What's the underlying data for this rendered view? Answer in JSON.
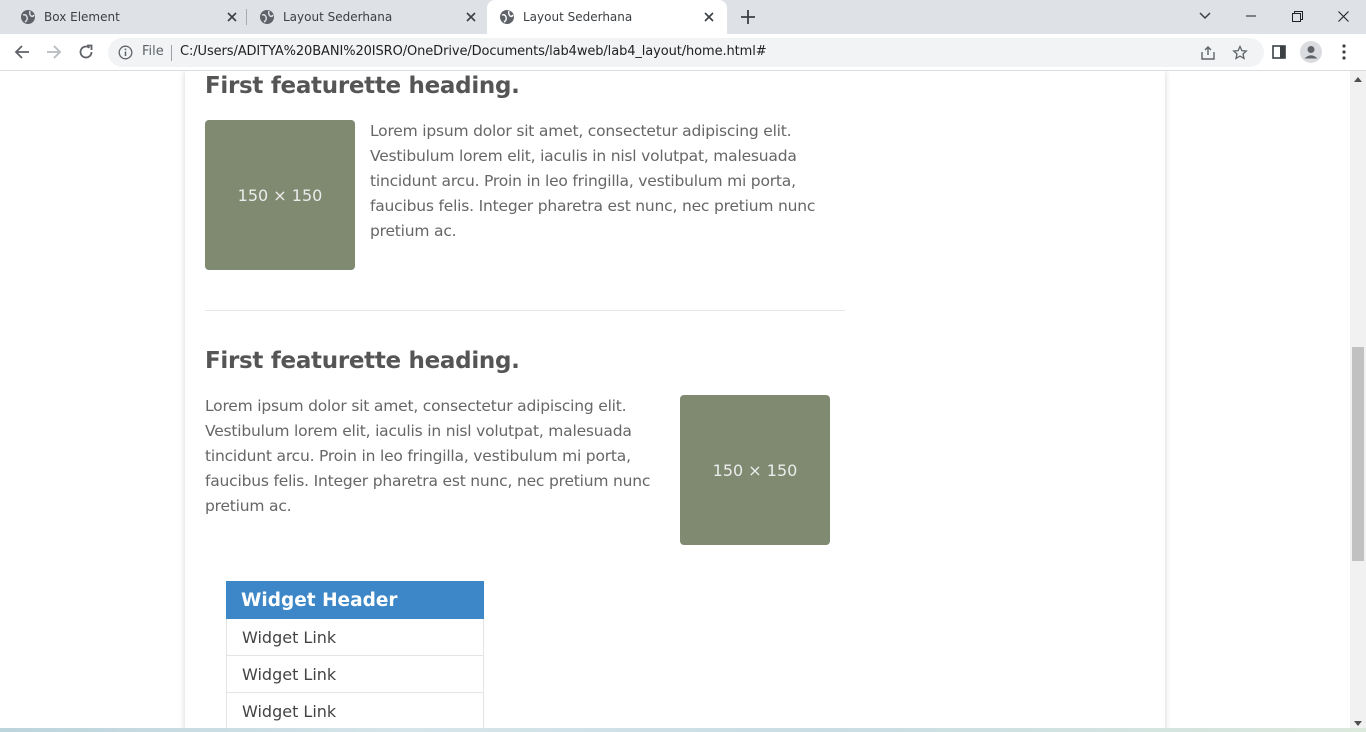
{
  "browser": {
    "tabs": [
      {
        "title": "Box Element",
        "active": false
      },
      {
        "title": "Layout Sederhana",
        "active": false
      },
      {
        "title": "Layout Sederhana",
        "active": true
      }
    ],
    "address": {
      "scheme_label": "File",
      "url": "C:/Users/ADITYA%20BANI%20ISRO/OneDrive/Documents/lab4web/lab4_layout/home.html#"
    }
  },
  "page": {
    "featurette_1": {
      "heading": "First featurette heading.",
      "text": "Lorem ipsum dolor sit amet, consectetur adipiscing elit. Vestibulum lorem elit, iaculis in nisl volutpat, malesuada tincidunt arcu. Proin in leo fringilla, vestibulum mi porta, faucibus felis. Integer pharetra est nunc, nec pretium nunc pretium ac.",
      "image_label": "150 × 150"
    },
    "featurette_2": {
      "heading": "First featurette heading.",
      "text": "Lorem ipsum dolor sit amet, consectetur adipiscing elit. Vestibulum lorem elit, iaculis in nisl volutpat, malesuada tincidunt arcu. Proin in leo fringilla, vestibulum mi porta, faucibus felis. Integer pharetra est nunc, nec pretium nunc pretium ac.",
      "image_label": "150 × 150"
    },
    "widget": {
      "header": "Widget Header",
      "links": [
        "Widget Link",
        "Widget Link",
        "Widget Link"
      ]
    }
  },
  "colors": {
    "placeholder": "#7f8a71",
    "widget_header": "#3d87c8",
    "heading_text": "#555555"
  }
}
